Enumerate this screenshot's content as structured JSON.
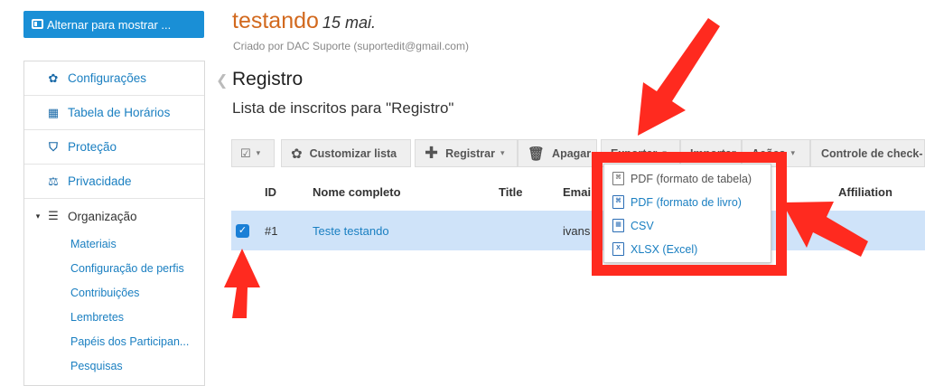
{
  "toggle": {
    "label": "Alternar para mostrar ..."
  },
  "event": {
    "title": "testando",
    "date": "15 mai.",
    "created_by": "Criado por DAC Suporte (suportedit@gmail.com)"
  },
  "sidebar": {
    "items": [
      {
        "label": "Configurações",
        "icon": "gear-icon"
      },
      {
        "label": "Tabela de Horários",
        "icon": "calendar-icon"
      },
      {
        "label": "Proteção",
        "icon": "shield-icon"
      },
      {
        "label": "Privacidade",
        "icon": "scale-icon"
      },
      {
        "label": "Organização",
        "icon": "list-icon"
      }
    ],
    "subitems": [
      "Materiais",
      "Configuração de perfis",
      "Contribuições",
      "Lembretes",
      "Papéis dos Participan...",
      "Pesquisas"
    ]
  },
  "section": {
    "title": "Registro",
    "subtitle": "Lista de inscritos para \"Registro\""
  },
  "toolbar": {
    "customize": "Customizar lista",
    "register": "Registrar",
    "delete": "Apagar",
    "export": "Exportar",
    "import": "Importar",
    "actions": "Ações",
    "checkin": "Controle de check-"
  },
  "table": {
    "headers": {
      "id": "ID",
      "name": "Nome completo",
      "title": "Title",
      "email": "Emai",
      "affiliation": "Affiliation"
    },
    "rows": [
      {
        "id": "#1",
        "name": "Teste testando",
        "email": "ivans",
        "checked": true
      }
    ]
  },
  "export_menu": {
    "items": [
      {
        "label": "PDF (formato de tabela)",
        "icon": "pdf-icon"
      },
      {
        "label": "PDF (formato de livro)",
        "icon": "pdf-icon"
      },
      {
        "label": "CSV",
        "icon": "csv-icon"
      },
      {
        "label": "XLSX (Excel)",
        "icon": "excel-icon"
      }
    ]
  },
  "colors": {
    "accent": "#1a8fd6",
    "link": "#1a7fc1",
    "event_title": "#d2691e",
    "annotation": "#ff2a1f",
    "selected_row": "#cfe3f9"
  }
}
